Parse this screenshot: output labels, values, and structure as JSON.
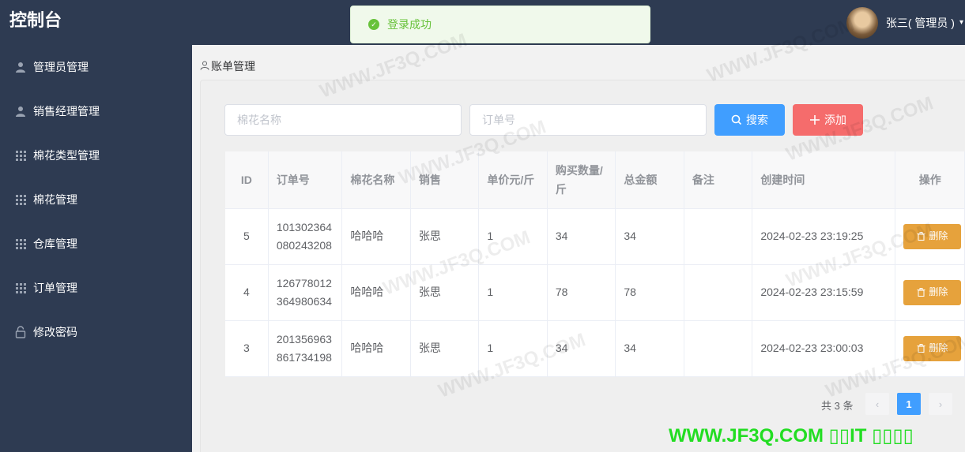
{
  "header": {
    "title": "控制台",
    "user": "张三( 管理员 )",
    "caret": "▾"
  },
  "toast": {
    "message": "登录成功"
  },
  "sidebar": {
    "items": [
      {
        "label": "管理员管理",
        "icon": "user-icon"
      },
      {
        "label": "销售经理管理",
        "icon": "user-icon"
      },
      {
        "label": "棉花类型管理",
        "icon": "grid-icon"
      },
      {
        "label": "棉花管理",
        "icon": "grid-icon"
      },
      {
        "label": "仓库管理",
        "icon": "grid-icon"
      },
      {
        "label": "订单管理",
        "icon": "grid-icon"
      },
      {
        "label": "修改密码",
        "icon": "lock-icon"
      }
    ]
  },
  "breadcrumb": {
    "label": "账单管理"
  },
  "search": {
    "cotton_placeholder": "棉花名称",
    "order_placeholder": "订单号",
    "search_label": "搜索",
    "add_label": "添加"
  },
  "table": {
    "headers": [
      "ID",
      "订单号",
      "棉花名称",
      "销售",
      "单价元/斤",
      "购买数量/斤",
      "总金额",
      "备注",
      "创建时间",
      "操作"
    ],
    "rows": [
      {
        "id": "5",
        "order": "101302364080243208",
        "cotton": "哈哈哈",
        "sales": "张思",
        "price": "1",
        "qty": "34",
        "total": "34",
        "remark": "",
        "created": "2024-02-23 23:19:25",
        "action": "删除"
      },
      {
        "id": "4",
        "order": "126778012364980634",
        "cotton": "哈哈哈",
        "sales": "张思",
        "price": "1",
        "qty": "78",
        "total": "78",
        "remark": "",
        "created": "2024-02-23 23:15:59",
        "action": "删除"
      },
      {
        "id": "3",
        "order": "201356963861734198",
        "cotton": "哈哈哈",
        "sales": "张思",
        "price": "1",
        "qty": "34",
        "total": "34",
        "remark": "",
        "created": "2024-02-23 23:00:03",
        "action": "删除"
      }
    ]
  },
  "pagination": {
    "total_label": "共 3 条",
    "current_page": "1",
    "prev": "‹",
    "next": "›"
  },
  "watermark": {
    "text": "WWW.JF3Q.COM",
    "text_corner": "WWW.JF3Q.COM ▯▯IT ▯▯▯▯"
  },
  "colors": {
    "sidebar_bg": "#2e3b52",
    "primary": "#409eff",
    "danger": "#f56c6c",
    "warning": "#e6a23c",
    "success": "#67c23a"
  }
}
